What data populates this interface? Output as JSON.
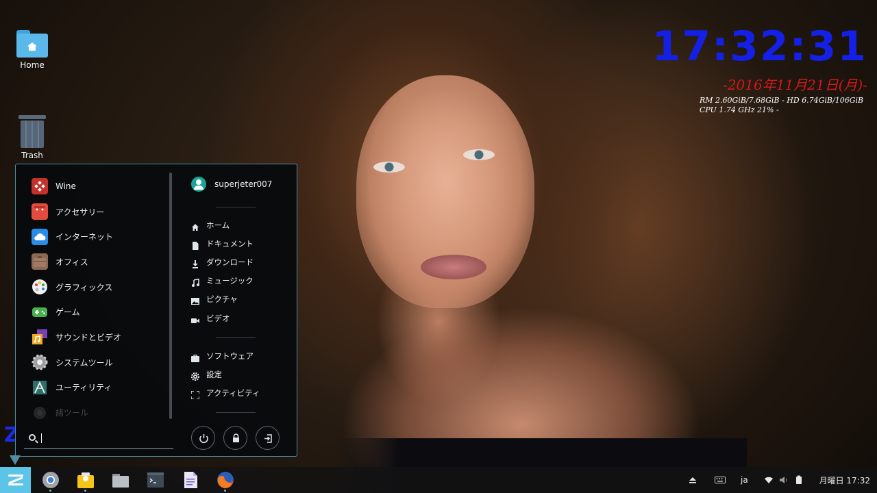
{
  "desktop": {
    "icons": [
      {
        "label": "Home"
      },
      {
        "label": "Trash"
      }
    ]
  },
  "conky": {
    "time": "17:32:31",
    "date": "-2016年11月21日(月)-",
    "memory_line": "RM 2.60GiB/7.68GiB - HD 6.74GiB/106GiB",
    "cpu_line": "CPU 1.74 GHz 21% -",
    "colors": {
      "time": "#1420e6",
      "date": "#d4181c"
    },
    "corner_mark": "Z"
  },
  "start_menu": {
    "categories": [
      {
        "label": "Wine",
        "icon": "wine-icon",
        "color": "#c4302b"
      },
      {
        "label": "アクセサリー",
        "icon": "accessories-icon",
        "color": "#e34b3f"
      },
      {
        "label": "インターネット",
        "icon": "internet-cloud-icon",
        "color": "#2b8ce6"
      },
      {
        "label": "オフィス",
        "icon": "office-briefcase-icon",
        "color": "#8a6a55"
      },
      {
        "label": "グラフィックス",
        "icon": "graphics-palette-icon",
        "color": "#f2f2f2"
      },
      {
        "label": "ゲーム",
        "icon": "games-controller-icon",
        "color": "#4caf50"
      },
      {
        "label": "サウンドとビデオ",
        "icon": "sound-video-icon",
        "color": "#f5a623"
      },
      {
        "label": "システムツール",
        "icon": "system-tools-gear-icon",
        "color": "#8c8c8c"
      },
      {
        "label": "ユーティリティ",
        "icon": "utilities-icon",
        "color": "#3f8f8a"
      },
      {
        "label": "諸ツール",
        "icon": "misc-tools-icon",
        "color": "#777777"
      }
    ],
    "search": {
      "value": "",
      "placeholder": ""
    },
    "user": {
      "name": "superjeter007"
    },
    "places": [
      {
        "label": "ホーム",
        "icon": "home-icon"
      },
      {
        "label": "ドキュメント",
        "icon": "document-icon"
      },
      {
        "label": "ダウンロード",
        "icon": "download-icon"
      },
      {
        "label": "ミュージック",
        "icon": "music-icon"
      },
      {
        "label": "ピクチャ",
        "icon": "picture-icon"
      },
      {
        "label": "ビデオ",
        "icon": "video-icon"
      }
    ],
    "system": [
      {
        "label": "ソフトウェア",
        "icon": "software-bag-icon"
      },
      {
        "label": "設定",
        "icon": "settings-gear-icon"
      },
      {
        "label": "アクティビティ",
        "icon": "activities-icon"
      }
    ],
    "actions": [
      {
        "name": "power-button",
        "icon": "power-icon"
      },
      {
        "name": "lock-button",
        "icon": "lock-icon"
      },
      {
        "name": "logout-button",
        "icon": "logout-icon"
      }
    ],
    "border_color": "#4f8fa6"
  },
  "taskbar": {
    "apps": [
      {
        "name": "chrome",
        "icon": "chrome-icon"
      },
      {
        "name": "photos",
        "icon": "photos-icon"
      },
      {
        "name": "files",
        "icon": "files-icon"
      },
      {
        "name": "terminal",
        "icon": "terminal-icon"
      },
      {
        "name": "text-editor",
        "icon": "text-editor-icon"
      },
      {
        "name": "firefox",
        "icon": "firefox-icon"
      }
    ],
    "tray": {
      "keyboard_layout": "ja",
      "clock": "月曜日 17:32"
    },
    "accent": "#5cc4e6"
  }
}
